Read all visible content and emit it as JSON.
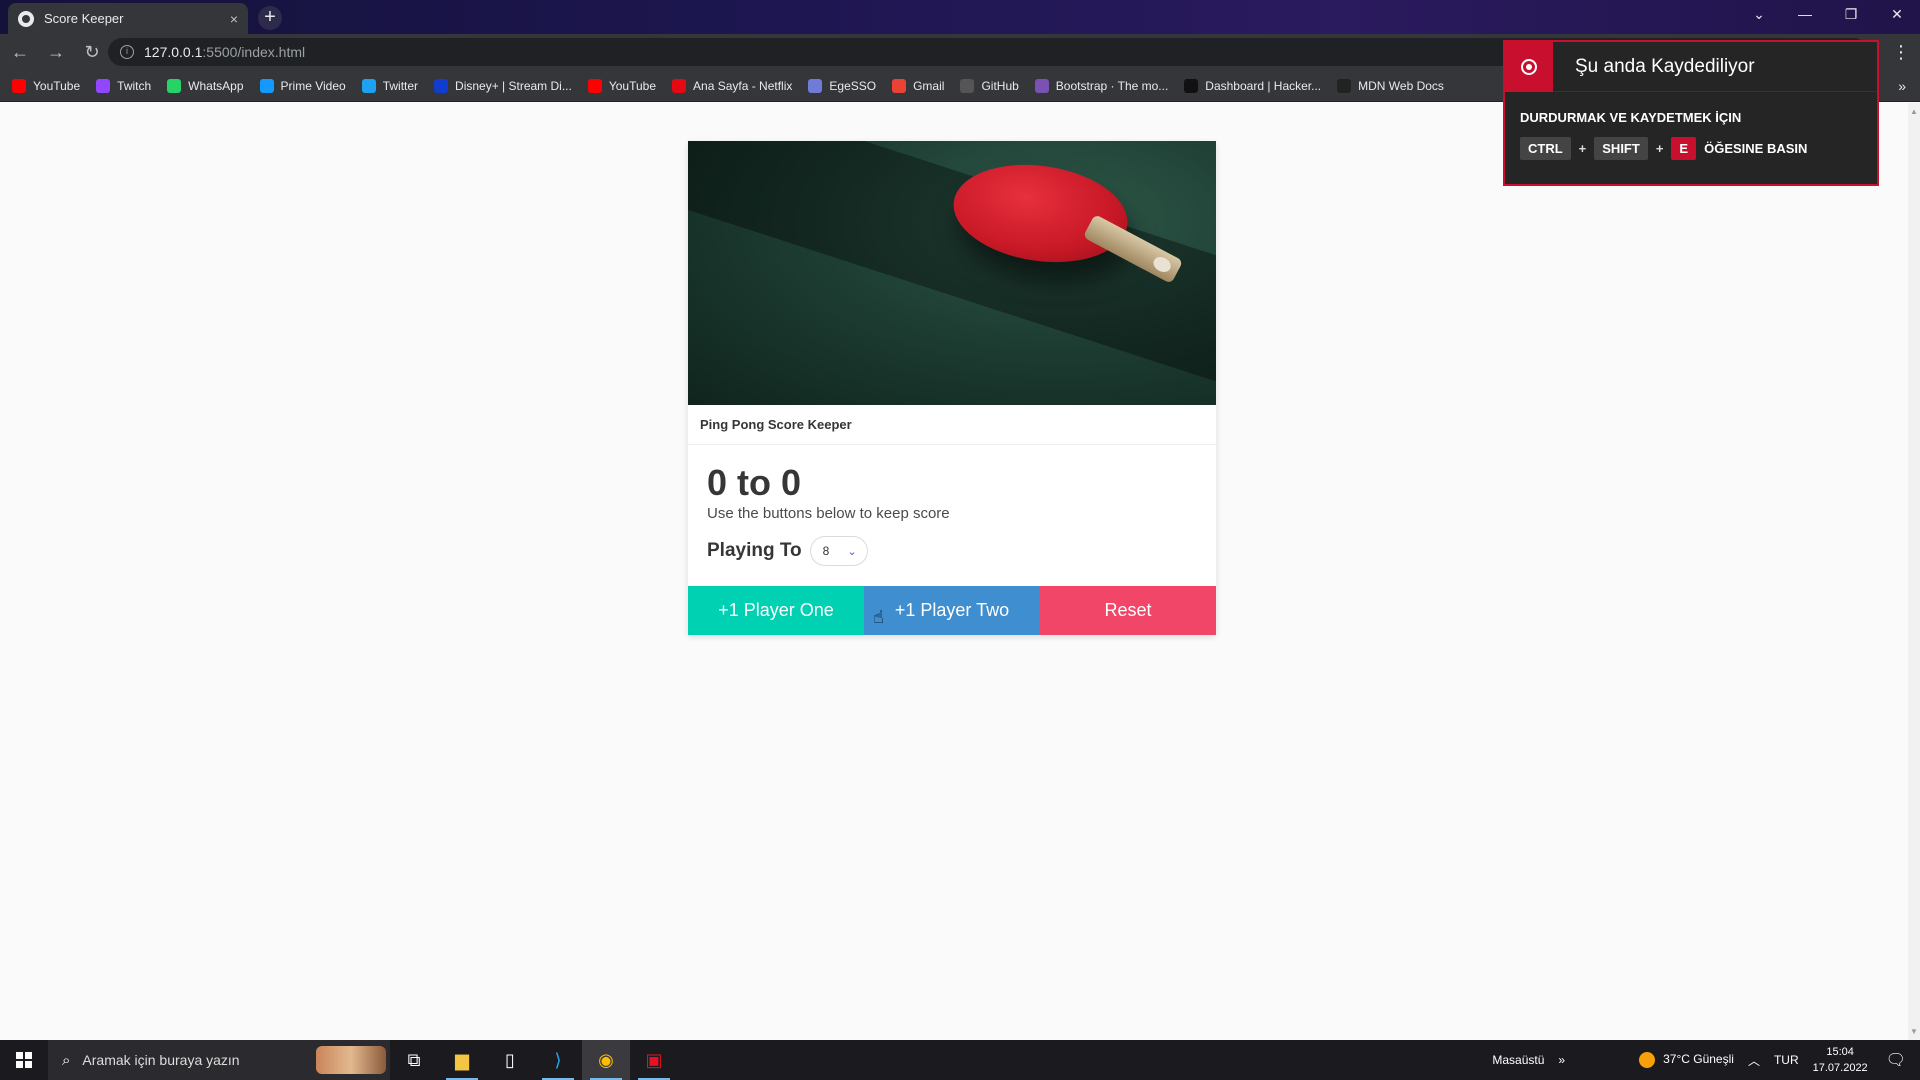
{
  "browser": {
    "tab_title": "Score Keeper",
    "tab_close": "×",
    "new_tab": "+",
    "url_host": "127.0.0.1",
    "url_path": ":5500/index.html",
    "bookmarks": [
      {
        "label": "YouTube",
        "icon": "youtube-icon",
        "color": "#ff0000"
      },
      {
        "label": "Twitch",
        "icon": "twitch-icon",
        "color": "#9146ff"
      },
      {
        "label": "WhatsApp",
        "icon": "whatsapp-icon",
        "color": "#25d366"
      },
      {
        "label": "Prime Video",
        "icon": "prime-video-icon",
        "color": "#1399ff"
      },
      {
        "label": "Twitter",
        "icon": "twitter-icon",
        "color": "#1da1f2"
      },
      {
        "label": "Disney+ | Stream Di...",
        "icon": "disney-icon",
        "color": "#113ccf"
      },
      {
        "label": "YouTube",
        "icon": "youtube-icon",
        "color": "#ff0000"
      },
      {
        "label": "Ana Sayfa - Netflix",
        "icon": "netflix-icon",
        "color": "#e50914"
      },
      {
        "label": "EgeSSO",
        "icon": "egesso-icon",
        "color": "#6f7bd6"
      },
      {
        "label": "Gmail",
        "icon": "gmail-icon",
        "color": "#ea4335"
      },
      {
        "label": "GitHub",
        "icon": "github-icon",
        "color": "#555555"
      },
      {
        "label": "Bootstrap · The mo...",
        "icon": "bootstrap-icon",
        "color": "#7952b3"
      },
      {
        "label": "Dashboard | Hacker...",
        "icon": "hackerrank-icon",
        "color": "#111111"
      },
      {
        "label": "MDN Web Docs",
        "icon": "mdn-icon",
        "color": "#222222"
      }
    ]
  },
  "app": {
    "card_title": "Ping Pong Score Keeper",
    "score_display": "0 to 0",
    "subtitle": "Use the buttons below to keep score",
    "playing_to_label": "Playing To",
    "playing_to_value": "8",
    "buttons": {
      "player_one": "+1 Player One",
      "player_two": "+1 Player Two",
      "reset": "Reset"
    },
    "colors": {
      "player_one": "#00d1b2",
      "player_two": "#3e8ed0",
      "reset": "#f14668"
    }
  },
  "recording_overlay": {
    "title": "Şu anda Kaydediliyor",
    "instruction": "DURDURMAK VE KAYDETMEK İÇIN",
    "keys": [
      "CTRL",
      "SHIFT",
      "E"
    ],
    "suffix": "ÖĞESINE BASIN"
  },
  "taskbar": {
    "search_placeholder": "Aramak için buraya yazın",
    "desktop_label": "Masaüstü",
    "weather": "37°C  Güneşli",
    "language": "TUR",
    "time": "15:04",
    "date": "17.07.2022"
  }
}
